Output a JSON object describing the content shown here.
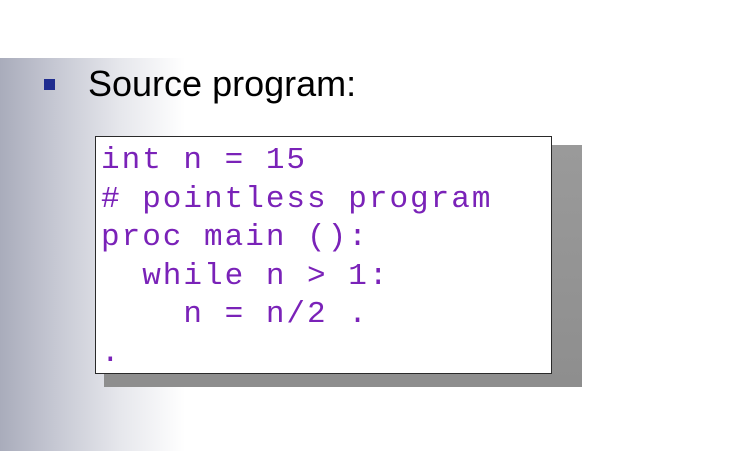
{
  "slide": {
    "bullet_text": "Source program:"
  },
  "code": {
    "lines": [
      "int n = 15",
      "# pointless program",
      "proc main ():",
      "  while n > 1:",
      "    n = n/2 .",
      "."
    ]
  },
  "colors": {
    "bullet": "#1f2c8f",
    "code_text": "#7a22b8",
    "shadow": "#919191"
  },
  "icons": {
    "bullet": "square-bullet-icon"
  }
}
